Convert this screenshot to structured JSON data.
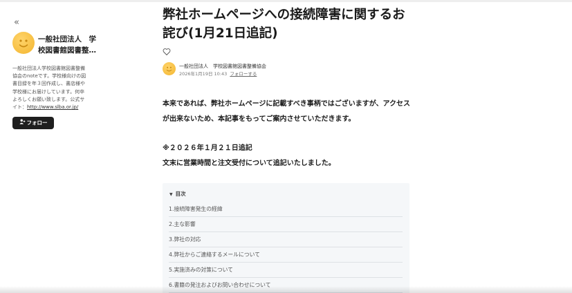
{
  "sidebar": {
    "collapse_glyph": "«",
    "creator_name": "一般社団法人　学校図書館図書整備協会",
    "bio_text": "一般社団法人学校図書館図書整備協会のnoteです。学校様向けの図書目録を年３回作成し、書店様や学校様にお届けしています。何卒よろしくお願い致します。公式サイト：",
    "bio_link": "http://www.slba.or.jp/",
    "follow_label": "フォロー"
  },
  "article": {
    "title": "弊社ホームページへの接続障害に関するお詫び(1月21日追記)",
    "author": "一般社団法人　学校図書館図書整備協会",
    "date": "2026年1月19日 10:43",
    "follow_label": "フォローする",
    "paragraph1": "本来であれば、弊社ホームページに記載すべき事柄ではございますが、アクセスが出来ないため、本記事をもってご案内させていただきます。",
    "note_line1": "※２０２６年１月２１日追記",
    "note_line2": "文末に営業時間と注文受付について追記いたしました。"
  },
  "toc": {
    "heading": "目次",
    "items": [
      "1.接続障害発生の経緯",
      "2.主な影響",
      "3.弊社の対応",
      "4.弊社からご連絡するメールについて",
      "5.実施済みの対策について",
      "6.書籍の発注およびお問い合わせについて"
    ]
  }
}
